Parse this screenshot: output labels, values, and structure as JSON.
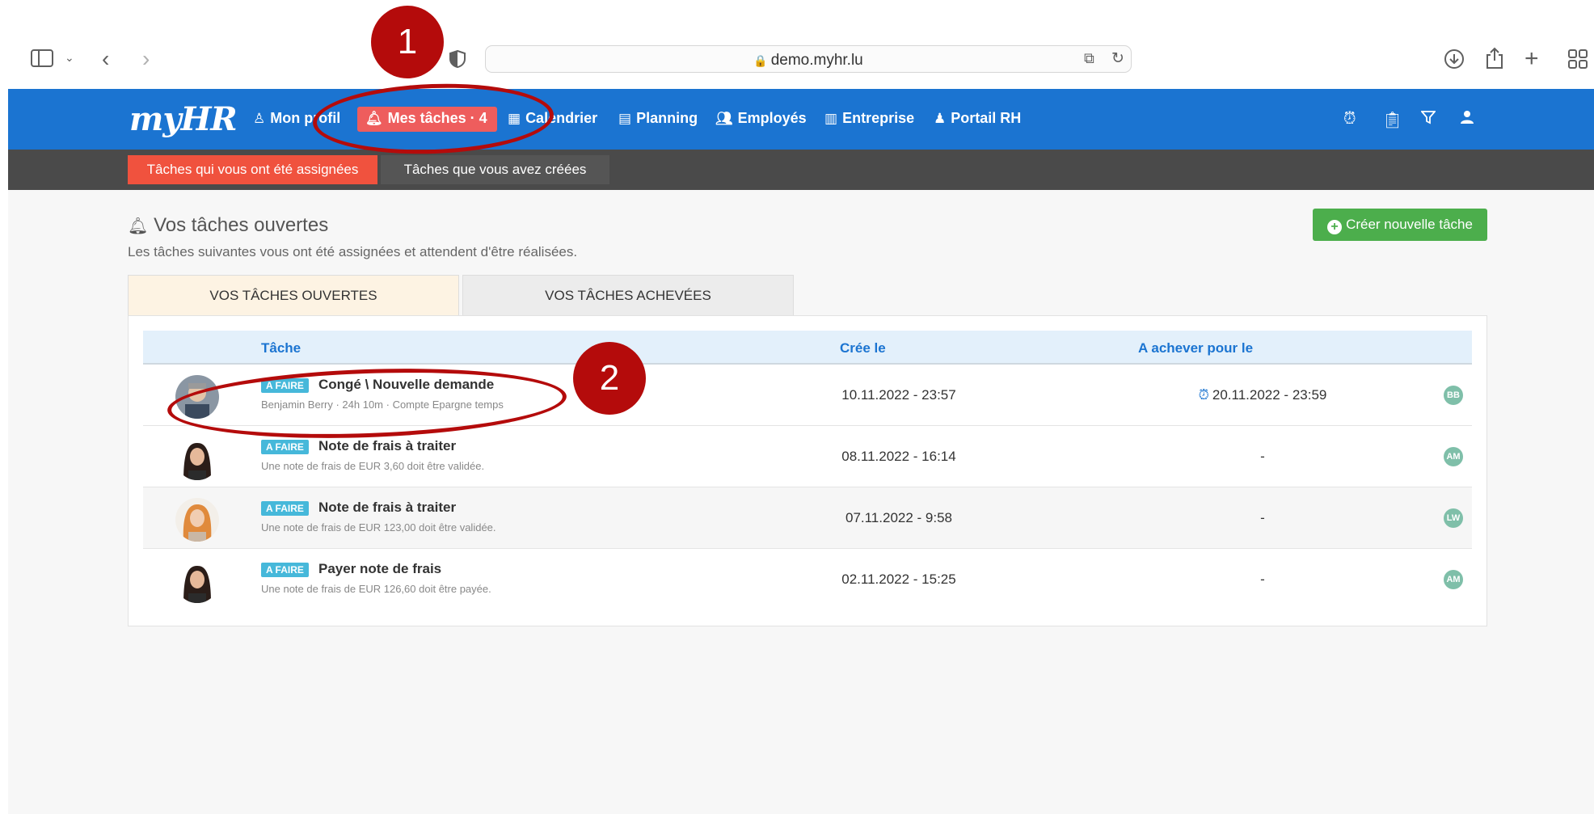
{
  "browser": {
    "url": "demo.myhr.lu"
  },
  "nav": {
    "logo": "myHR",
    "items": [
      {
        "label": "Mon profil",
        "icon": "user-icon"
      },
      {
        "label": "Mes tâches · 4",
        "icon": "bell-icon"
      },
      {
        "label": "Calendrier",
        "icon": "calendar-icon"
      },
      {
        "label": "Planning",
        "icon": "planning-icon"
      },
      {
        "label": "Employés",
        "icon": "users-icon"
      },
      {
        "label": "Entreprise",
        "icon": "building-icon"
      },
      {
        "label": "Portail RH",
        "icon": "portal-icon"
      }
    ]
  },
  "subnav": {
    "assigned": "Tâches qui vous ont été assignées",
    "created": "Tâches que vous avez créées"
  },
  "page": {
    "title": "Vos tâches ouvertes",
    "subtitle": "Les tâches suivantes vous ont été assignées et attendent d'être réalisées.",
    "create_button": "Créer nouvelle tâche",
    "tab_open": "VOS TÂCHES OUVERTES",
    "tab_done": "VOS TÂCHES ACHEVÉES"
  },
  "table": {
    "col_task": "Tâche",
    "col_created": "Crée le",
    "col_due": "A achever pour le",
    "rows": [
      {
        "badge": "A FAIRE",
        "title": "Congé \\ Nouvelle demande",
        "sub": "Benjamin Berry · 24h 10m · Compte Epargne temps",
        "created": "10.11.2022 - 23:57",
        "due": "20.11.2022 - 23:59",
        "initials": "BB"
      },
      {
        "badge": "A FAIRE",
        "title": "Note de frais à traiter",
        "sub": "Une note de frais de EUR 3,60 doit être validée.",
        "created": "08.11.2022 - 16:14",
        "due": "-",
        "initials": "AM"
      },
      {
        "badge": "A FAIRE",
        "title": "Note de frais à traiter",
        "sub": "Une note de frais de EUR 123,00 doit être validée.",
        "created": "07.11.2022 - 9:58",
        "due": "-",
        "initials": "LW"
      },
      {
        "badge": "A FAIRE",
        "title": "Payer note de frais",
        "sub": "Une note de frais de EUR 126,60 doit être payée.",
        "created": "02.11.2022 - 15:25",
        "due": "-",
        "initials": "AM"
      }
    ]
  },
  "annotations": {
    "marker1": "1",
    "marker2": "2",
    "color": "#b40b0b"
  },
  "colors": {
    "navbar": "#1b74d1",
    "active_nav": "#ee5d5d",
    "active_subtab": "#f0523e",
    "create_button": "#4cae4c",
    "badge": "#46b8da"
  }
}
